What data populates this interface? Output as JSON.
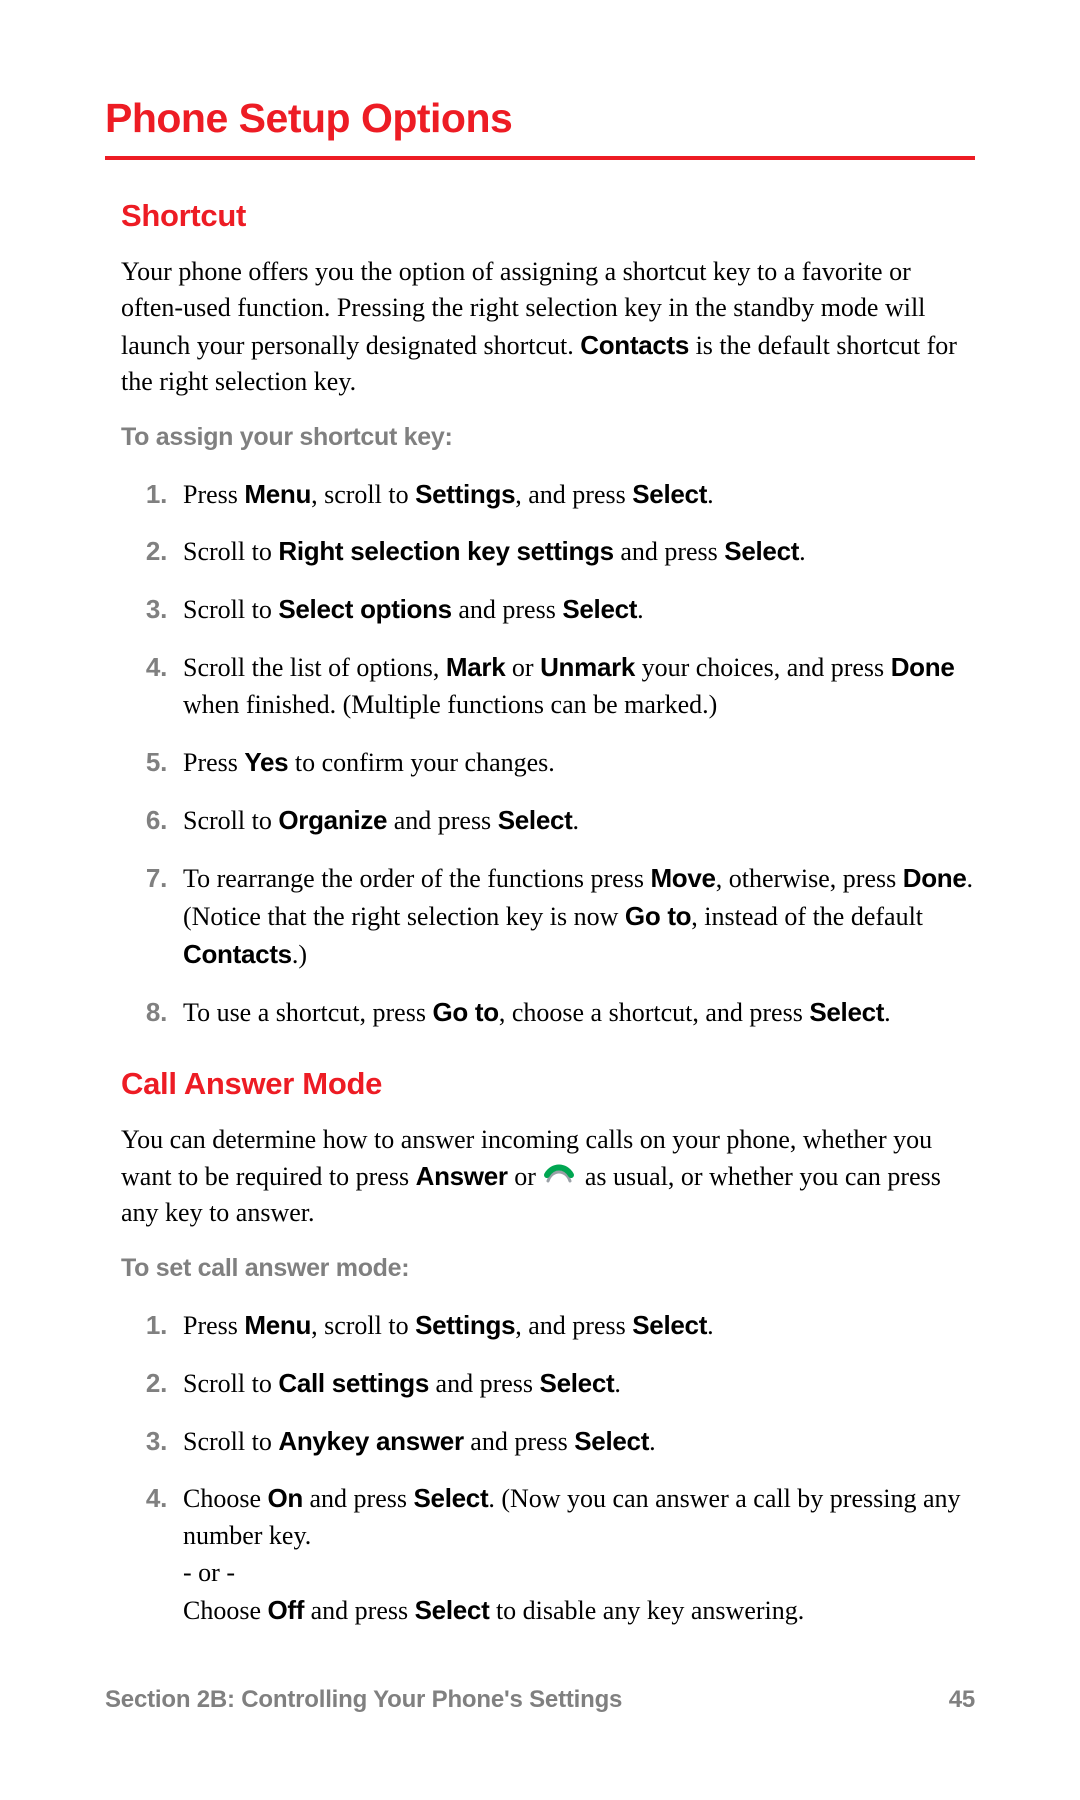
{
  "title": "Phone Setup Options",
  "shortcut": {
    "heading": "Shortcut",
    "intro_parts": [
      "Your phone offers you the option of assigning a shortcut key to a favorite or often-used function. Pressing the right selection key in the standby mode will launch your personally designated shortcut. ",
      "Contacts",
      " is the default shortcut for the right selection key."
    ],
    "subhead": "To assign your shortcut key:",
    "steps": [
      [
        [
          "t",
          "Press "
        ],
        [
          "b",
          "Menu"
        ],
        [
          "t",
          ", scroll to "
        ],
        [
          "b",
          "Settings"
        ],
        [
          "t",
          ", and press "
        ],
        [
          "b",
          "Select"
        ],
        [
          "t",
          "."
        ]
      ],
      [
        [
          "t",
          "Scroll to "
        ],
        [
          "b",
          "Right selection key settings"
        ],
        [
          "t",
          " and press "
        ],
        [
          "b",
          "Select"
        ],
        [
          "t",
          "."
        ]
      ],
      [
        [
          "t",
          "Scroll to "
        ],
        [
          "b",
          "Select options"
        ],
        [
          "t",
          " and press "
        ],
        [
          "b",
          "Select"
        ],
        [
          "t",
          "."
        ]
      ],
      [
        [
          "t",
          "Scroll the list of options, "
        ],
        [
          "b",
          "Mark"
        ],
        [
          "t",
          " or "
        ],
        [
          "b",
          "Unmark"
        ],
        [
          "t",
          " your choices, and press "
        ],
        [
          "b",
          "Done"
        ],
        [
          "t",
          " when finished. (Multiple functions can be marked.)"
        ]
      ],
      [
        [
          "t",
          "Press "
        ],
        [
          "b",
          "Yes"
        ],
        [
          "t",
          " to confirm your changes."
        ]
      ],
      [
        [
          "t",
          "Scroll to "
        ],
        [
          "b",
          "Organize"
        ],
        [
          "t",
          " and press "
        ],
        [
          "b",
          "Select"
        ],
        [
          "t",
          "."
        ]
      ],
      [
        [
          "t",
          "To rearrange the order of the functions press "
        ],
        [
          "b",
          "Move"
        ],
        [
          "t",
          ", otherwise, press "
        ],
        [
          "b",
          "Done"
        ],
        [
          "t",
          ". (Notice that the right selection key is now "
        ],
        [
          "b",
          "Go to"
        ],
        [
          "t",
          ", instead of the default "
        ],
        [
          "b",
          "Contacts"
        ],
        [
          "t",
          ".)"
        ]
      ],
      [
        [
          "t",
          "To use a shortcut, press "
        ],
        [
          "b",
          "Go to"
        ],
        [
          "t",
          ", choose a shortcut, and press "
        ],
        [
          "b",
          "Select"
        ],
        [
          "t",
          "."
        ]
      ]
    ]
  },
  "call_answer": {
    "heading": "Call Answer Mode",
    "intro_parts": [
      [
        "t",
        "You can determine how to answer incoming calls on your phone, whether you want to be required to press "
      ],
      [
        "b",
        "Answer"
      ],
      [
        "t",
        " or "
      ],
      [
        "icon",
        "call-icon"
      ],
      [
        "t",
        " as usual, or whether you can press any key to answer."
      ]
    ],
    "subhead": "To set call answer mode:",
    "steps": [
      [
        [
          "t",
          "Press "
        ],
        [
          "b",
          "Menu"
        ],
        [
          "t",
          ", scroll to "
        ],
        [
          "b",
          "Settings"
        ],
        [
          "t",
          ", and press "
        ],
        [
          "b",
          "Select"
        ],
        [
          "t",
          "."
        ]
      ],
      [
        [
          "t",
          "Scroll to "
        ],
        [
          "b",
          "Call settings"
        ],
        [
          "t",
          " and press "
        ],
        [
          "b",
          "Select"
        ],
        [
          "t",
          "."
        ]
      ],
      [
        [
          "t",
          "Scroll to "
        ],
        [
          "b",
          "Anykey answer"
        ],
        [
          "t",
          " and press "
        ],
        [
          "b",
          "Select"
        ],
        [
          "t",
          "."
        ]
      ],
      [
        [
          "t",
          "Choose "
        ],
        [
          "b",
          "On"
        ],
        [
          "t",
          " and press "
        ],
        [
          "b",
          "Select"
        ],
        [
          "t",
          ". (Now you can answer a call by pressing any number key."
        ],
        [
          "br",
          ""
        ],
        [
          "t",
          "- or -"
        ],
        [
          "br",
          ""
        ],
        [
          "t",
          "Choose "
        ],
        [
          "b",
          "Off"
        ],
        [
          "t",
          " and press "
        ],
        [
          "b",
          "Select"
        ],
        [
          "t",
          " to disable any key answering."
        ]
      ]
    ]
  },
  "footer": {
    "section": "Section 2B: Controlling Your Phone's Settings",
    "page": "45"
  }
}
